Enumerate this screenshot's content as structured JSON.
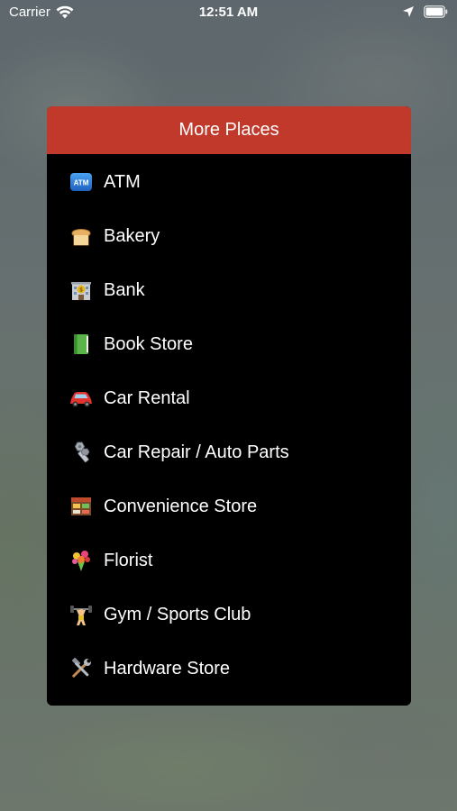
{
  "status_bar": {
    "carrier": "Carrier",
    "time": "12:51 AM",
    "icons": [
      "wifi-icon",
      "location-arrow-icon",
      "battery-icon"
    ]
  },
  "panel": {
    "title": "More Places",
    "header_color": "#c0392b",
    "items": [
      {
        "label": "ATM",
        "icon": "atm-icon"
      },
      {
        "label": "Bakery",
        "icon": "bread-icon"
      },
      {
        "label": "Bank",
        "icon": "bank-building-icon"
      },
      {
        "label": "Book Store",
        "icon": "green-book-icon"
      },
      {
        "label": "Car Rental",
        "icon": "red-car-icon"
      },
      {
        "label": "Car Repair / Auto Parts",
        "icon": "nut-and-bolt-icon"
      },
      {
        "label": "Convenience Store",
        "icon": "convenience-store-icon"
      },
      {
        "label": "Florist",
        "icon": "bouquet-icon"
      },
      {
        "label": "Gym / Sports Club",
        "icon": "weightlifter-icon"
      },
      {
        "label": "Hardware Store",
        "icon": "hammer-and-wrench-icon"
      }
    ]
  }
}
